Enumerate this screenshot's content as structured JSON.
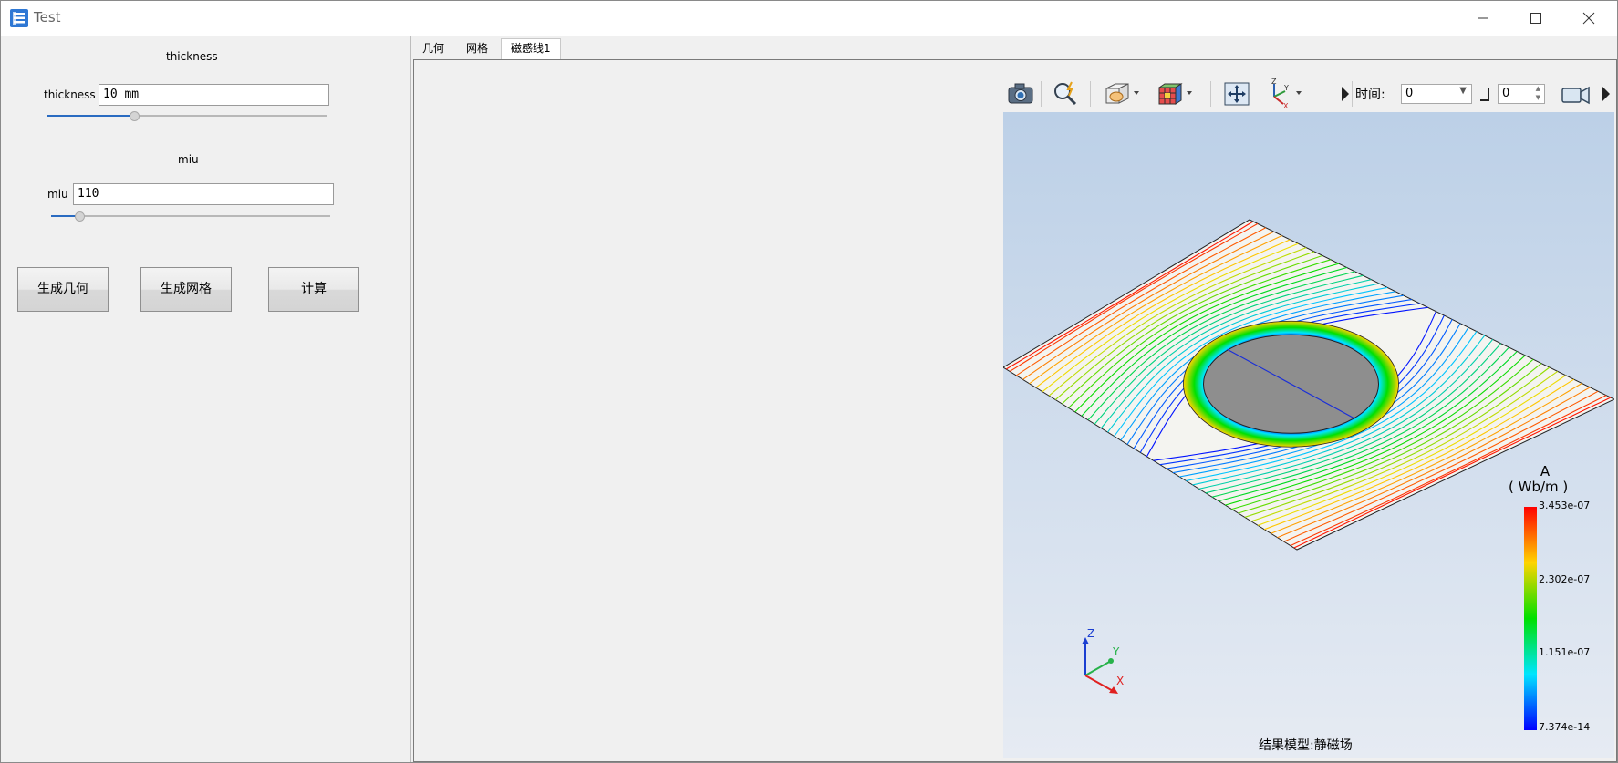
{
  "window": {
    "title": "Test"
  },
  "params": {
    "thickness": {
      "section_title": "thickness",
      "label": "thickness",
      "value": "10 mm",
      "slider_fraction": 0.31
    },
    "miu": {
      "section_title": "miu",
      "label": "miu",
      "value": "110",
      "slider_fraction": 0.1
    }
  },
  "buttons": {
    "geometry": "生成几何",
    "mesh": "生成网格",
    "compute": "计算"
  },
  "tabs": [
    {
      "label": "几何",
      "active": false
    },
    {
      "label": "网格",
      "active": false
    },
    {
      "label": "磁感线1",
      "active": true
    }
  ],
  "toolbar": {
    "time_label": "时间:",
    "time_value": "0",
    "step_value": "0"
  },
  "viewport": {
    "model_label": "结果模型:静磁场",
    "legend": {
      "quantity": "A",
      "unit": "( Wb/m )",
      "max": "3.453e-07",
      "t2": "2.302e-07",
      "t1": "1.151e-07",
      "min": "7.374e-14"
    },
    "axes": {
      "z": "Z",
      "y": "Y",
      "x": "X"
    },
    "background_top": "#bcd0e7",
    "background_bottom": "#e6ebf3"
  }
}
